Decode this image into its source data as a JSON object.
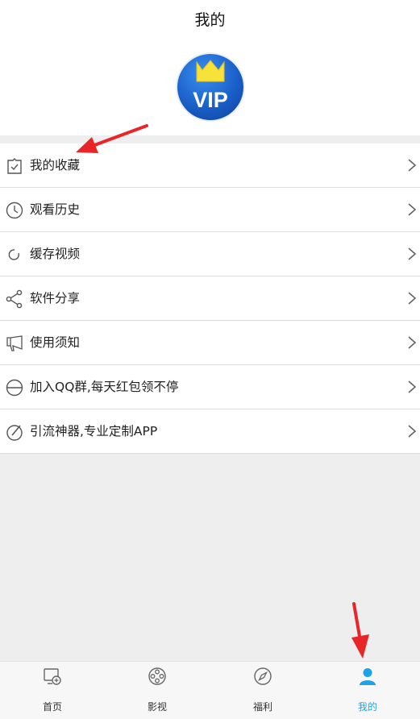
{
  "header": {
    "title": "我的",
    "badge_text": "VIP"
  },
  "menu": {
    "items": [
      {
        "label": "我的收藏",
        "icon": "favorites-icon"
      },
      {
        "label": "观看历史",
        "icon": "clock-icon"
      },
      {
        "label": "缓存视频",
        "icon": "refresh-icon"
      },
      {
        "label": "软件分享",
        "icon": "share-icon"
      },
      {
        "label": "使用须知",
        "icon": "megaphone-icon"
      },
      {
        "label": "加入QQ群,每天红包领不停",
        "icon": "circle-dash-icon"
      },
      {
        "label": "引流神器,专业定制APP",
        "icon": "edit-circle-icon"
      }
    ]
  },
  "tabbar": {
    "tabs": [
      {
        "label": "首页",
        "icon": "home-tv-icon",
        "active": false
      },
      {
        "label": "影视",
        "icon": "film-reel-icon",
        "active": false
      },
      {
        "label": "福利",
        "icon": "compass-icon",
        "active": false
      },
      {
        "label": "我的",
        "icon": "user-icon",
        "active": true
      }
    ]
  },
  "colors": {
    "accent": "#1fa3e8",
    "background": "#eeeeee",
    "annotation_arrow": "#e8262a",
    "vip_blue": "#1a5fc8",
    "crown_yellow": "#f7e23a"
  }
}
